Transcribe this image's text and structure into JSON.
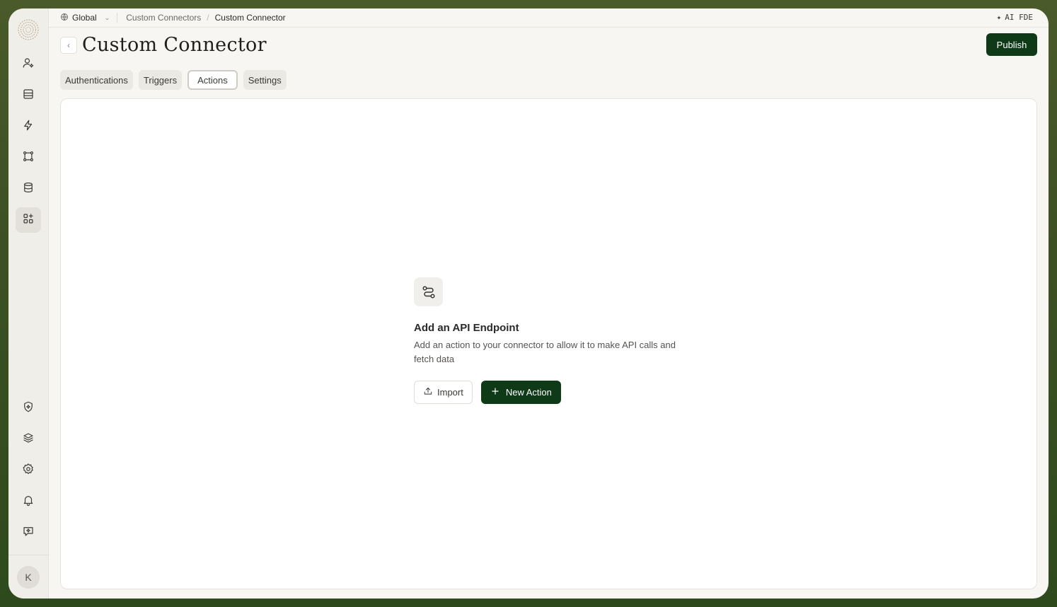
{
  "colors": {
    "accent": "#0f3a17",
    "background": "#f7f6f3",
    "sidebar": "#f0eee9",
    "outer_frame": "#3d5024"
  },
  "sidebar": {
    "logo_icon": "spiral-logo-icon",
    "top_items": [
      {
        "icon": "user-sparkle-icon",
        "active": false
      },
      {
        "icon": "inbox-icon",
        "active": false
      },
      {
        "icon": "lightning-icon",
        "active": false
      },
      {
        "icon": "workflow-nodes-icon",
        "active": false
      },
      {
        "icon": "database-icon",
        "active": false
      },
      {
        "icon": "apps-plus-icon",
        "active": true
      }
    ],
    "bottom_items": [
      {
        "icon": "shield-sparkle-icon"
      },
      {
        "icon": "layers-icon"
      },
      {
        "icon": "gear-icon"
      },
      {
        "icon": "bell-icon"
      },
      {
        "icon": "feedback-icon"
      }
    ],
    "avatar_initial": "K"
  },
  "topbar": {
    "scope_label": "Global",
    "breadcrumbs": [
      "Custom Connectors",
      "Custom Connector"
    ],
    "ai_label": "AI FDE"
  },
  "header": {
    "title": "Custom Connector",
    "publish_label": "Publish"
  },
  "tabs": [
    {
      "label": "Authentications",
      "active": false
    },
    {
      "label": "Triggers",
      "active": false
    },
    {
      "label": "Actions",
      "active": true
    },
    {
      "label": "Settings",
      "active": false
    }
  ],
  "empty_state": {
    "icon": "route-icon",
    "title": "Add an API Endpoint",
    "description": "Add an action to your connector to allow it to make API calls and fetch data",
    "import_label": "Import",
    "new_action_label": "New Action"
  }
}
